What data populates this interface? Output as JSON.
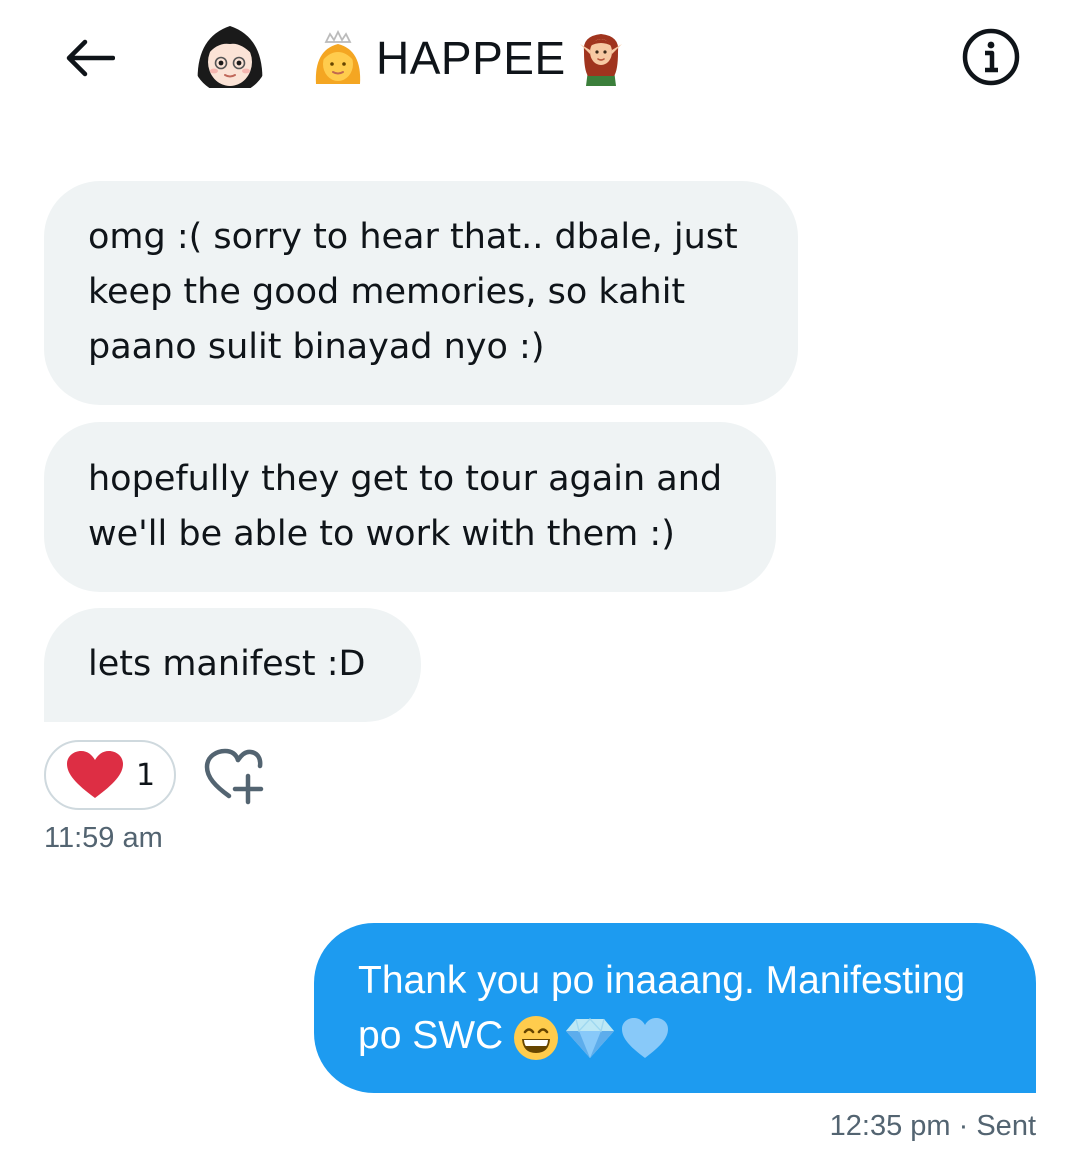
{
  "header": {
    "title": "HAPPEE",
    "back_icon": "arrow-left-icon",
    "info_icon": "info-icon",
    "title_prefix_emoji": "person-with-crown-emoji",
    "title_suffix_emoji": "elf-emoji"
  },
  "messages_in": [
    {
      "line1": "omg :( sorry to hear that.. dbale, just",
      "line2": "keep the good memories, so kahit",
      "line3": "paano sulit binayad nyo :)"
    },
    {
      "line1": "hopefully they get to tour again and",
      "line2": "we'll be able to work with them :)"
    },
    {
      "line1": "lets manifest :D"
    }
  ],
  "reaction": {
    "icon": "heart-icon",
    "count": "1",
    "color": "#e0245e"
  },
  "timestamp_in": "11:59 am",
  "message_out": {
    "line1": "Thank you po inaaang. Manifesting",
    "line2": "po SWC",
    "emojis": [
      "grinning-face-emoji",
      "gem-emoji",
      "blue-heart-emoji"
    ]
  },
  "timestamp_out": "12:35 pm · Sent",
  "colors": {
    "accent": "#1d9bf0",
    "bubble_in": "#eff3f4",
    "muted": "#536471"
  }
}
